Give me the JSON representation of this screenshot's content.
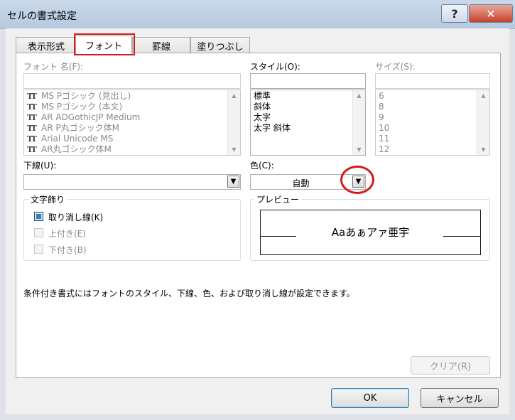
{
  "window": {
    "title": "セルの書式設定",
    "help_label": "?",
    "close_label": "✕"
  },
  "tabs": [
    {
      "label": "表示形式"
    },
    {
      "label": "フォント"
    },
    {
      "label": "罫線"
    },
    {
      "label": "塗りつぶし"
    }
  ],
  "font": {
    "label": "フォント 名(F):",
    "value": "",
    "items": [
      "MS Pゴシック (見出し)",
      "MS Pゴシック (本文)",
      "AR ADGothicJP Medium",
      "AR P丸ゴシック体M",
      "Arial Unicode MS",
      "AR丸ゴシック体M"
    ]
  },
  "style": {
    "label": "スタイル(O):",
    "value": "",
    "items": [
      "標準",
      "斜体",
      "太字",
      "太字 斜体"
    ]
  },
  "size": {
    "label": "サイズ(S):",
    "value": "",
    "items": [
      "6",
      "8",
      "9",
      "10",
      "11",
      "12"
    ]
  },
  "underline": {
    "label": "下線(U):",
    "value": ""
  },
  "color": {
    "label": "色(C):",
    "value": "自動"
  },
  "effects": {
    "title": "文字飾り",
    "strikethrough": {
      "label": "取り消し線(K)",
      "checked": true
    },
    "superscript": {
      "label": "上付き(E)",
      "checked": false
    },
    "subscript": {
      "label": "下付き(B)",
      "checked": false
    }
  },
  "preview": {
    "title": "プレビュー",
    "sample": "Aaあぁアァ亜宇"
  },
  "info_text": "条件付き書式にはフォントのスタイル、下線、色、および取り消し線が設定できます。",
  "buttons": {
    "clear": "クリア(R)",
    "ok": "OK",
    "cancel": "キャンセル"
  },
  "icons": {
    "scroll_up": "▲",
    "scroll_down": "▼",
    "dropdown": "▼",
    "font_type": "TT"
  },
  "colors": {
    "annotation_red": "#d31b1b",
    "checkbox_checked": "#3c7fb1",
    "title_bar": "#c9d9ea"
  }
}
